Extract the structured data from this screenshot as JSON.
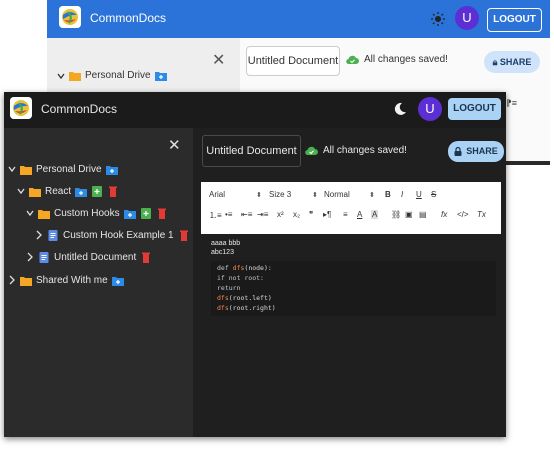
{
  "colors": {
    "header_light": "#2b73d8",
    "folder": "#f5a623",
    "action_blue": "#2b8be6",
    "action_green": "#4caf50",
    "delete_red": "#e53935",
    "doc_blue": "#5b8ce6",
    "avatar_purple": "#5b2fd3",
    "saved_green": "#4caf50"
  },
  "back_window": {
    "app_title": "CommonDocs",
    "theme_toggle_icon": "sun-icon",
    "avatar_letter": "U",
    "logout_label": "LOGOUT",
    "sidebar_root_label": "Personal Drive",
    "doc_name": "Untitled Document",
    "saved_status": "All changes saved!",
    "share_label": "SHARE"
  },
  "front_window": {
    "app_title": "CommonDocs",
    "theme_toggle_icon": "moon-icon",
    "avatar_letter": "U",
    "logout_label": "LOGOUT",
    "sidebar": {
      "close_label": "✕",
      "tree": [
        {
          "label": "Personal Drive",
          "type": "folder",
          "depth": 0,
          "expanded": true,
          "actions": [
            "new-folder"
          ]
        },
        {
          "label": "React",
          "type": "folder",
          "depth": 1,
          "expanded": true,
          "actions": [
            "new-folder",
            "new-doc",
            "delete"
          ]
        },
        {
          "label": "Custom Hooks",
          "type": "folder",
          "depth": 2,
          "expanded": true,
          "actions": [
            "new-folder",
            "new-doc",
            "delete"
          ]
        },
        {
          "label": "Custom Hook Example 1",
          "type": "doc",
          "depth": 3,
          "expanded": false,
          "actions": [
            "delete"
          ]
        },
        {
          "label": "Untitled Document",
          "type": "doc",
          "depth": 2,
          "expanded": false,
          "actions": [
            "delete"
          ]
        },
        {
          "label": "Shared With me",
          "type": "folder",
          "depth": 0,
          "expanded": false,
          "actions": [
            "new-folder"
          ]
        }
      ]
    },
    "doc_name": "Untitled Document",
    "saved_status": "All changes saved!",
    "share_label": "SHARE",
    "toolbar": {
      "font": "Arial",
      "size": "Size 3",
      "style": "Normal",
      "bold": "B",
      "italic": "I",
      "underline": "U",
      "strike": "S",
      "superscript": "x²",
      "subscript": "x₂",
      "quote": "❞",
      "formula": "fx",
      "code": "</>",
      "clear": "Tx"
    },
    "editor": {
      "line1": "aaaa bbb",
      "line2": "abc123",
      "code_lines": [
        {
          "kw": "def ",
          "fn": "dfs",
          "rest": "(node):"
        },
        {
          "kw": "if not root:",
          "fn": "",
          "rest": ""
        },
        {
          "kw": "return",
          "fn": "",
          "rest": ""
        },
        {
          "kw": "",
          "fn": "dfs",
          "rest": "(root.left)"
        },
        {
          "kw": "",
          "fn": "dfs",
          "rest": "(root.right)"
        }
      ]
    }
  }
}
